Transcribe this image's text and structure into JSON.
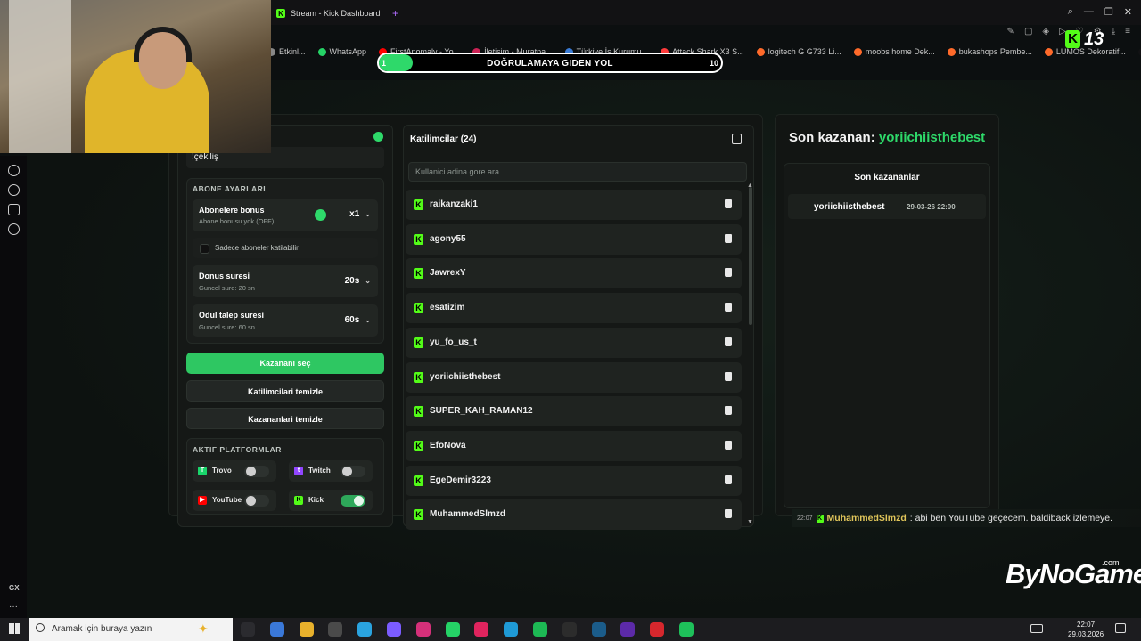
{
  "browser": {
    "tab_title": "Stream - Kick Dashboard",
    "new_tab": "+",
    "win_controls": [
      "⌕",
      "—",
      "❐",
      "✕"
    ],
    "bookmarks": [
      {
        "label": "Etkinl...",
        "color": "#888888"
      },
      {
        "label": "WhatsApp",
        "color": "#25d366"
      },
      {
        "label": "FirstAnomaly - Yo...",
        "color": "#ff0000"
      },
      {
        "label": "İletişim - Muratpa...",
        "color": "#cc2255"
      },
      {
        "label": "Türkiye İş Kurumu...",
        "color": "#3a7bd5"
      },
      {
        "label": "Attack Shark X3 S...",
        "color": "#ff3b3b"
      },
      {
        "label": "logitech G G733 Li...",
        "color": "#ff6a2a"
      },
      {
        "label": "moobs home Dek...",
        "color": "#ff6a2a"
      },
      {
        "label": "bukashops Pembe...",
        "color": "#ff6a2a"
      },
      {
        "label": "LUMOS Dekoratif...",
        "color": "#ff6a2a"
      },
      {
        "label": "»",
        "color": "#121214"
      }
    ],
    "toolbar_icons": [
      "pin-icon",
      "camera-icon",
      "shield-icon",
      "play-icon",
      "heart-icon",
      "settings-icon",
      "download-icon",
      "menu-icon"
    ]
  },
  "overlay": {
    "goal_start": "1",
    "goal_title": "DOĞRULAMAYA GIDEN YOL",
    "goal_end": "10",
    "goal_progress": 0.1,
    "kick_logo": "K",
    "kick_count": "13",
    "watermark": "ByNoGame",
    "watermark_suffix": ".com",
    "chat": {
      "time": "22:07",
      "user": "MuhammedSlmzd",
      "message": ": abi ben YouTube geçecem. baldiback izlemeye."
    }
  },
  "sidebar": {
    "gx_label": "GX",
    "more": "···"
  },
  "settings": {
    "keyword": "!çekiliş",
    "subscriber_section": "ABONE AYARLARI",
    "sub_bonus_title": "Abonelere bonus",
    "sub_bonus_sub": "Abone bonusu yok (OFF)",
    "sub_bonus_value": "x1",
    "only_subs_label": "Sadece aboneler katilabilir",
    "donus_title": "Donus suresi",
    "donus_sub": "Guncel sure: 20 sn",
    "donus_value": "20s",
    "odul_title": "Odul talep suresi",
    "odul_sub": "Guncel sure: 60 sn",
    "odul_value": "60s",
    "pick_winner_btn": "Kazananı seç",
    "clear_participants_btn": "Katilimcilari temizle",
    "clear_winners_btn": "Kazananlari temizle",
    "platforms_section": "AKTIF PLATFORMLAR",
    "platforms": [
      {
        "name": "Trovo",
        "enabled": false,
        "color": "#19d66b",
        "glyph": "T"
      },
      {
        "name": "Twitch",
        "enabled": false,
        "color": "#9146ff",
        "glyph": "t"
      },
      {
        "name": "YouTube",
        "enabled": false,
        "color": "#ff0000",
        "glyph": "▶"
      },
      {
        "name": "Kick",
        "enabled": true,
        "color": "#53fc18",
        "glyph": "K"
      }
    ]
  },
  "participants": {
    "title": "Katilimcilar (24)",
    "search_placeholder": "Kullanici adina gore ara...",
    "kick_glyph": "K",
    "list": [
      "raikanzaki1",
      "agony55",
      "JawrexY",
      "esatizim",
      "yu_fo_us_t",
      "yoriichiisthebest",
      "SUPER_KAH_RAMAN12",
      "EfoNova",
      "EgeDemir3223",
      "MuhammedSlmzd"
    ]
  },
  "winners": {
    "heading_prefix": "Son kazanan: ",
    "heading_name": "yoriichiisthebest",
    "list_title": "Son kazananlar",
    "list": [
      {
        "name": "yoriichiisthebest",
        "date": "29-03-26 22:00"
      }
    ]
  },
  "taskbar": {
    "search_placeholder": "Aramak için buraya yazın",
    "time": "22:07",
    "date": "29.03.2026",
    "apps": [
      {
        "name": "task-view",
        "color": "#2b2b2f"
      },
      {
        "name": "app-blue",
        "color": "#3a78d8"
      },
      {
        "name": "file-explorer",
        "color": "#e8b12c"
      },
      {
        "name": "app-gray",
        "color": "#4a4a4a"
      },
      {
        "name": "telegram",
        "color": "#2aa3df"
      },
      {
        "name": "discord",
        "color": "#7b5cff"
      },
      {
        "name": "instagram",
        "color": "#d6307a"
      },
      {
        "name": "whatsapp",
        "color": "#25d366"
      },
      {
        "name": "opera-gx",
        "color": "#e0245e"
      },
      {
        "name": "edge",
        "color": "#1f9ad6"
      },
      {
        "name": "spotify",
        "color": "#1db954"
      },
      {
        "name": "epic-games",
        "color": "#2c2c2c"
      },
      {
        "name": "steam",
        "color": "#1b5c8a"
      },
      {
        "name": "valorant",
        "color": "#5c2aa8"
      },
      {
        "name": "app-red",
        "color": "#d6272d"
      },
      {
        "name": "app-green",
        "color": "#1ec05a"
      }
    ]
  }
}
